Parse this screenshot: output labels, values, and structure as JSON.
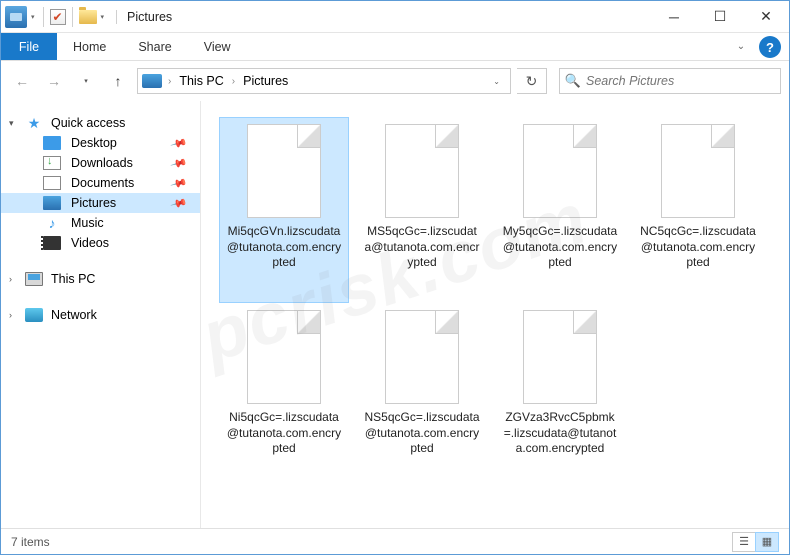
{
  "window": {
    "title": "Pictures"
  },
  "ribbon": {
    "file_label": "File",
    "tabs": [
      "Home",
      "Share",
      "View"
    ],
    "expand_glyph": "⌄",
    "help_glyph": "?"
  },
  "nav": {
    "back_glyph": "←",
    "fwd_glyph": "→",
    "hist_glyph": "▾",
    "up_glyph": "↑",
    "refresh_glyph": "↻",
    "address": {
      "segments": [
        "This PC",
        "Pictures"
      ],
      "chevron": "›",
      "dropdown_glyph": "⌄"
    },
    "search": {
      "placeholder": "Search Pictures",
      "icon": "🔍"
    }
  },
  "sidebar": {
    "quick": {
      "label": "Quick access",
      "twisty": "▾"
    },
    "quick_items": [
      {
        "label": "Desktop",
        "pinned": true,
        "icon": "ico-desk"
      },
      {
        "label": "Downloads",
        "pinned": true,
        "icon": "ico-down"
      },
      {
        "label": "Documents",
        "pinned": true,
        "icon": "ico-doc"
      },
      {
        "label": "Pictures",
        "pinned": true,
        "icon": "ico-pic",
        "selected": true
      },
      {
        "label": "Music",
        "pinned": false,
        "icon": "ico-mus"
      },
      {
        "label": "Videos",
        "pinned": false,
        "icon": "ico-vid"
      }
    ],
    "this_pc": {
      "label": "This PC",
      "twisty": "›"
    },
    "network": {
      "label": "Network",
      "twisty": "›"
    },
    "pin_glyph": "📌"
  },
  "files": [
    {
      "name": "Mi5qcGVn.lizscudata@tutanota.com.encrypted",
      "selected": true
    },
    {
      "name": "MS5qcGc=.lizscudata@tutanota.com.encrypted"
    },
    {
      "name": "My5qcGc=.lizscudata@tutanota.com.encrypted"
    },
    {
      "name": "NC5qcGc=.lizscudata@tutanota.com.encrypted"
    },
    {
      "name": "Ni5qcGc=.lizscudata@tutanota.com.encrypted"
    },
    {
      "name": "NS5qcGc=.lizscudata@tutanota.com.encrypted"
    },
    {
      "name": "ZGVza3RvcC5pbmk=.lizscudata@tutanota.com.encrypted"
    }
  ],
  "status": {
    "count_label": "7 items",
    "details_glyph": "☰",
    "thumbs_glyph": "▦"
  },
  "watermark": "pcrisk.com"
}
